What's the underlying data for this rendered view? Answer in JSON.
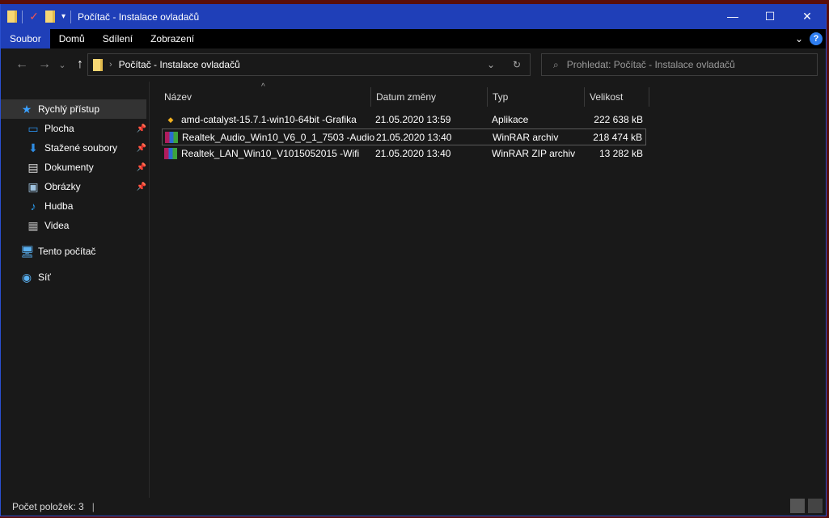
{
  "window": {
    "title": "Počítač - Instalace ovladačů",
    "minimize": "—",
    "maximize": "☐",
    "close": "✕"
  },
  "ribbon": {
    "tabs": [
      "Soubor",
      "Domů",
      "Sdílení",
      "Zobrazení"
    ],
    "expand": "⌄",
    "help": "?"
  },
  "nav": {
    "back": "←",
    "forward": "→",
    "recent": "⌄",
    "up": "↑"
  },
  "address": {
    "path": "Počítač - Instalace ovladačů",
    "separator": "›",
    "dropdown": "⌄",
    "refresh": "↻"
  },
  "search": {
    "placeholder": "Prohledat: Počítač - Instalace ovladačů",
    "icon": "⌕"
  },
  "sidebar": {
    "items": [
      {
        "label": "Rychlý přístup",
        "icon": "★",
        "color": "#3aa0ff"
      },
      {
        "label": "Plocha",
        "icon": "▭",
        "color": "#2a8ee8",
        "pinned": true
      },
      {
        "label": "Stažené soubory",
        "icon": "⬇",
        "color": "#2f8de4",
        "pinned": true
      },
      {
        "label": "Dokumenty",
        "icon": "▤",
        "color": "#dddddd",
        "pinned": true
      },
      {
        "label": "Obrázky",
        "icon": "▣",
        "color": "#9fc3e0",
        "pinned": true
      },
      {
        "label": "Hudba",
        "icon": "♪",
        "color": "#2a9df0"
      },
      {
        "label": "Videa",
        "icon": "▦",
        "color": "#aaaaaa"
      },
      {
        "label": "Tento počítač",
        "icon": "🖥",
        "color": "#5ab0f0"
      },
      {
        "label": "Síť",
        "icon": "◉",
        "color": "#5ab0f0"
      }
    ],
    "pin": "📌"
  },
  "columns": {
    "name": "Název",
    "date": "Datum změny",
    "type": "Typ",
    "size": "Velikost",
    "sort": "^"
  },
  "files": [
    {
      "name": "amd-catalyst-15.7.1-win10-64bit  -Grafika",
      "date": "21.05.2020 13:59",
      "type": "Aplikace",
      "size": "222 638 kB",
      "icon": "app"
    },
    {
      "name": "Realtek_Audio_Win10_V6_0_1_7503  -Audio",
      "date": "21.05.2020 13:40",
      "type": "WinRAR archiv",
      "size": "218 474 kB",
      "icon": "rar"
    },
    {
      "name": "Realtek_LAN_Win10_V1015052015  -Wifi",
      "date": "21.05.2020 13:40",
      "type": "WinRAR ZIP archiv",
      "size": "13 282 kB",
      "icon": "rar"
    }
  ],
  "status": {
    "count": "Počet položek: 3"
  }
}
